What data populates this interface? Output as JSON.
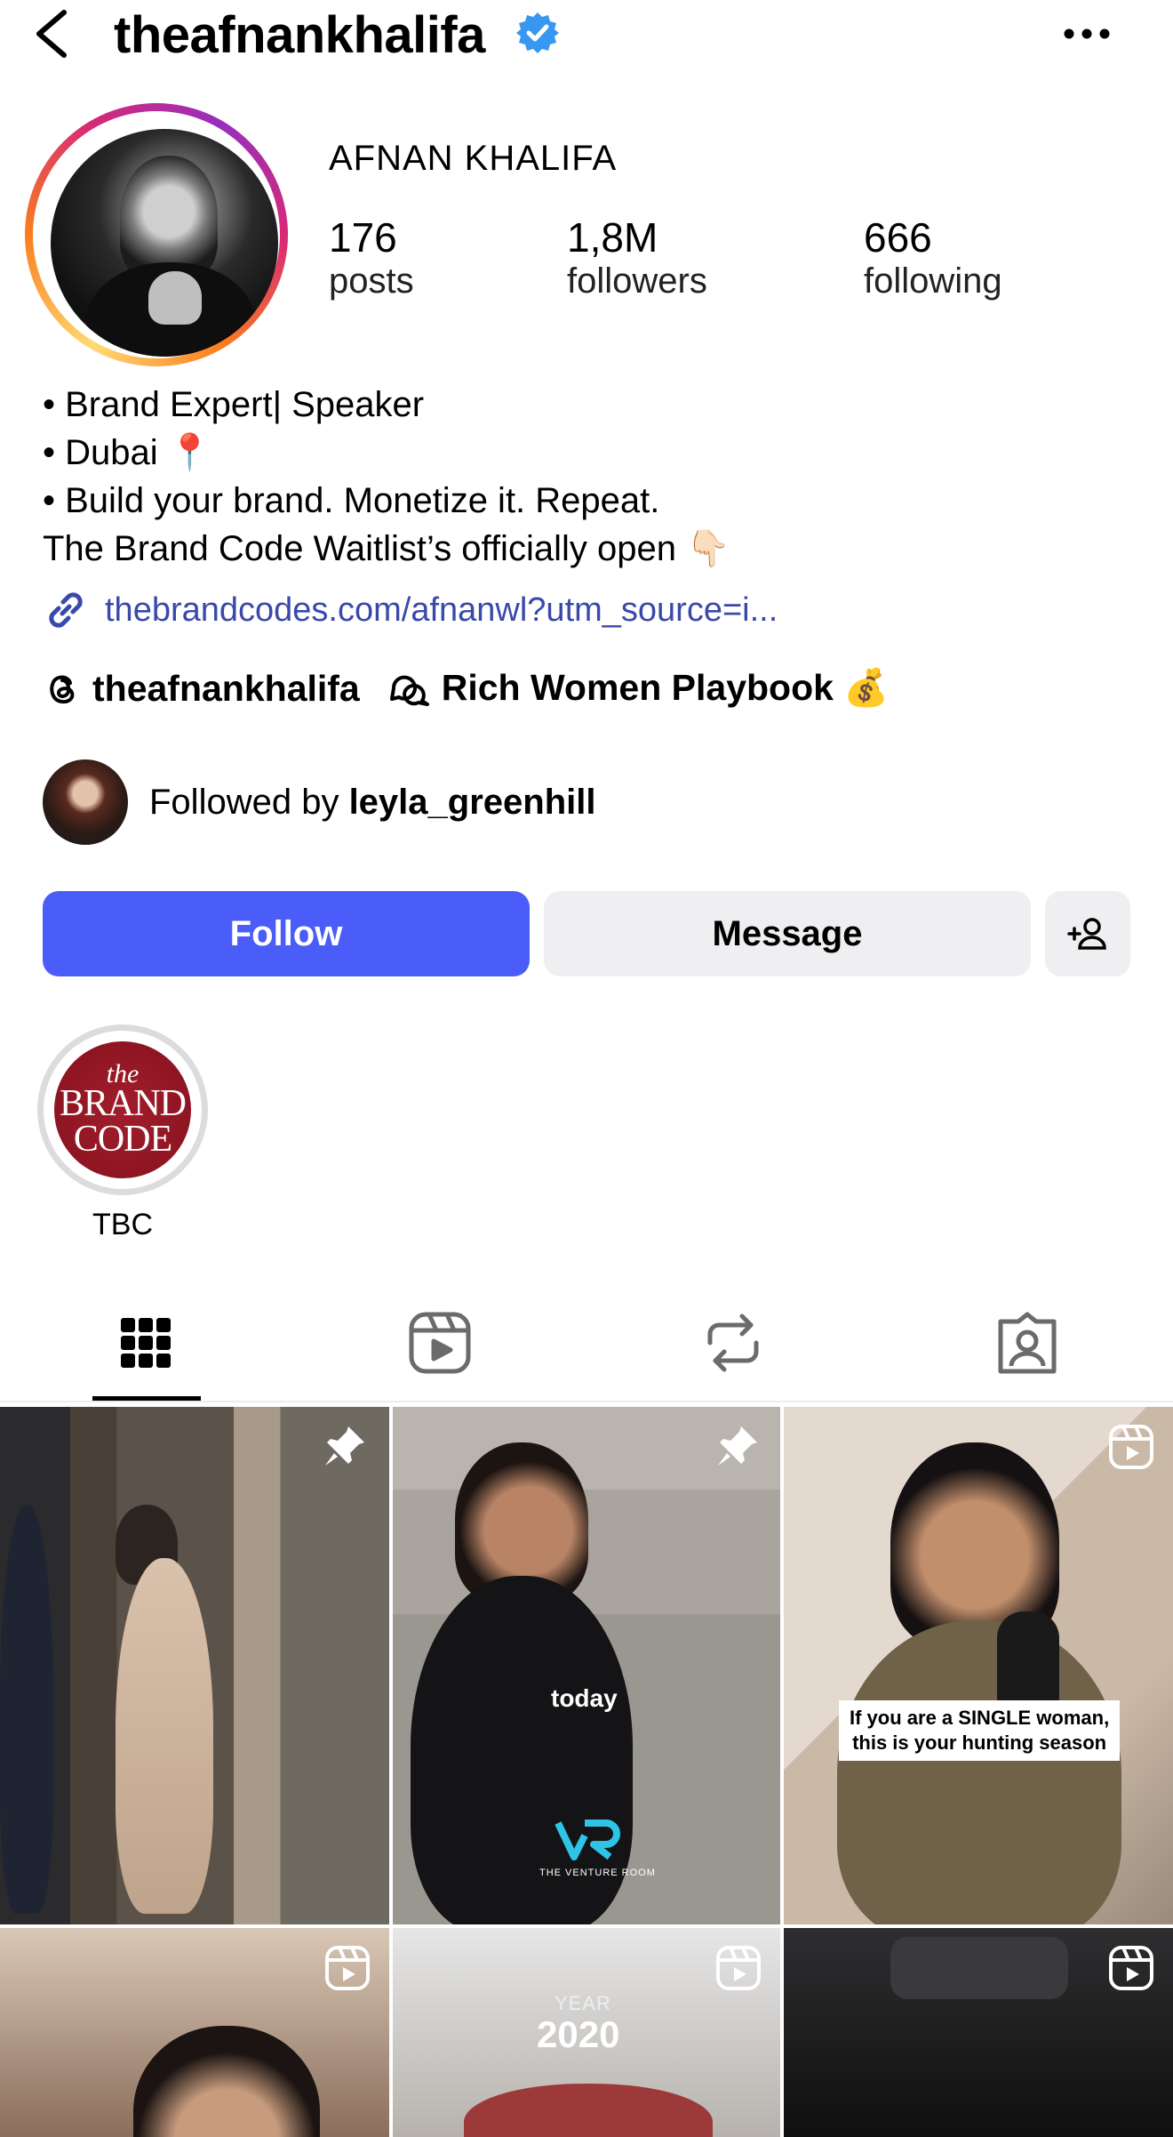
{
  "header": {
    "username": "theafnankhalifa",
    "verified_icon": "verified-badge-icon",
    "more_icon": "more-horizontal-icon"
  },
  "profile": {
    "full_name": "AFNAN KHALIFA",
    "stats": {
      "posts_count": "176",
      "posts_label": "posts",
      "followers_count": "1,8M",
      "followers_label": "followers",
      "following_count": "666",
      "following_label": "following"
    },
    "bio": [
      "• Brand Expert| Speaker",
      "• Dubai 📍",
      "• Build your brand. Monetize it. Repeat.",
      "The Brand Code Waitlist’s officially open 👇🏻"
    ],
    "link": "thebrandcodes.com/afnanwl?utm_source=i...",
    "threads_handle": "theafnankhalifa",
    "channel_name": "Rich Women Playbook 💰",
    "followed_by_prefix": "Followed by ",
    "followed_by_user": "leyla_greenhill"
  },
  "actions": {
    "follow_label": "Follow",
    "message_label": "Message"
  },
  "highlights": [
    {
      "label": "TBC",
      "cover_text_top": "the",
      "cover_text_mid": "BRAND",
      "cover_text_bot": "CODE"
    }
  ],
  "tabs": [
    "grid-icon",
    "reels-icon",
    "reposts-icon",
    "tagged-icon"
  ],
  "posts": {
    "post2_caption": "today",
    "post2_brand": "THE VENTURE ROOM",
    "post3_caption_line1": "If you are a SINGLE woman,",
    "post3_caption_line2": "this is your hunting season",
    "post5_label": "YEAR",
    "post5_year": "2020"
  },
  "colors": {
    "follow_button": "#4a5df9",
    "link": "#3949ab",
    "verified": "#3897f0"
  }
}
